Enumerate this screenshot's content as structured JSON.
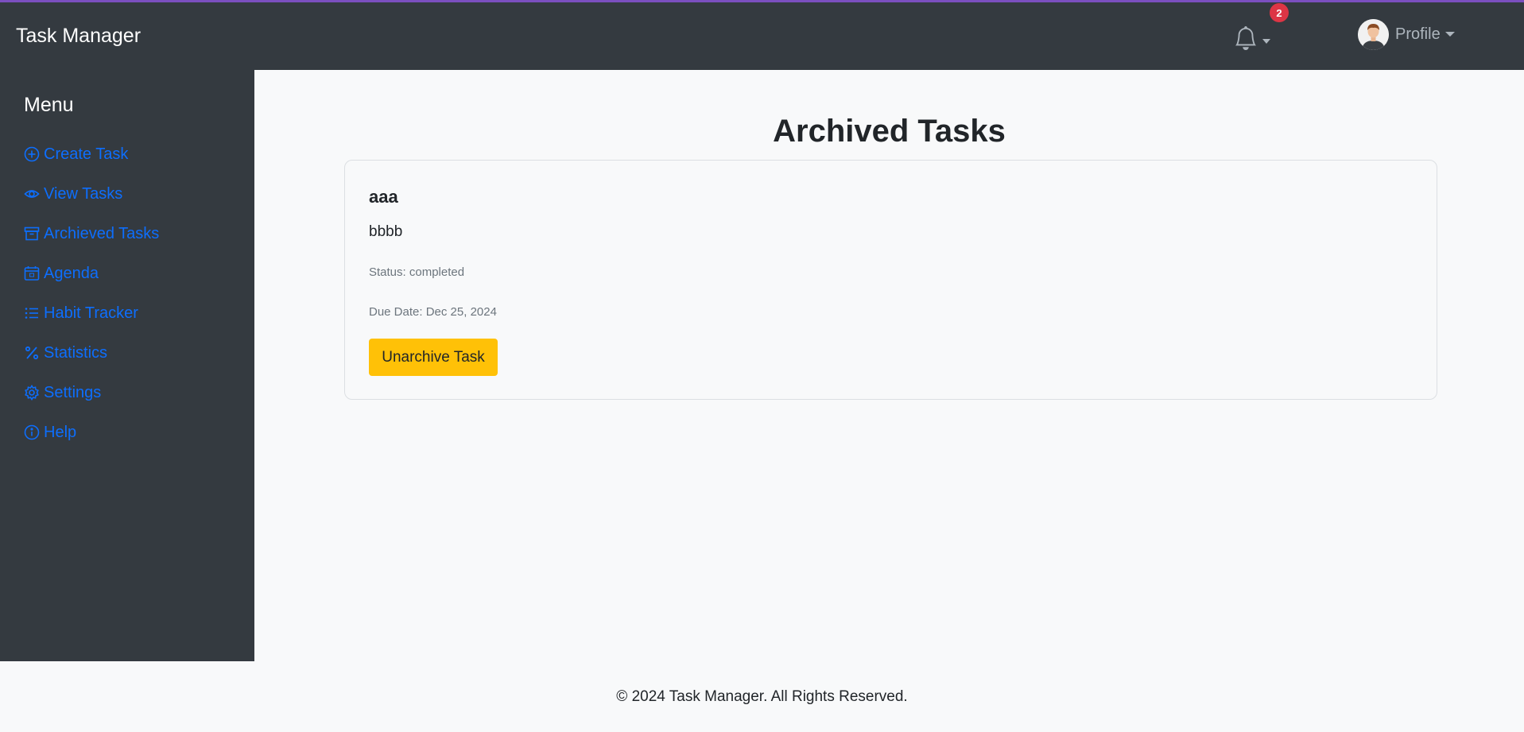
{
  "navbar": {
    "brand": "Task Manager",
    "notification_count": "2",
    "profile_label": "Profile"
  },
  "sidebar": {
    "title": "Menu",
    "items": [
      {
        "label": "Create Task",
        "icon": "plus-circle-icon"
      },
      {
        "label": "View Tasks",
        "icon": "eye-icon"
      },
      {
        "label": "Archieved Tasks",
        "icon": "archive-icon"
      },
      {
        "label": "Agenda",
        "icon": "calendar-icon"
      },
      {
        "label": "Habit Tracker",
        "icon": "list-icon"
      },
      {
        "label": "Statistics",
        "icon": "percent-icon"
      },
      {
        "label": "Settings",
        "icon": "gear-icon"
      },
      {
        "label": "Help",
        "icon": "info-circle-icon"
      }
    ]
  },
  "main": {
    "page_title": "Archived Tasks",
    "tasks": [
      {
        "title": "aaa",
        "description": "bbbb",
        "status": "Status: completed",
        "due_date": "Due Date: Dec 25, 2024",
        "button_label": "Unarchive Task"
      }
    ]
  },
  "footer": {
    "text": "© 2024 Task Manager. All Rights Reserved."
  },
  "colors": {
    "navbar_bg": "#343a40",
    "link": "#0d6efd",
    "warning_button": "#ffc107",
    "badge": "#dc3545",
    "top_accent": "#7b4fbf"
  }
}
